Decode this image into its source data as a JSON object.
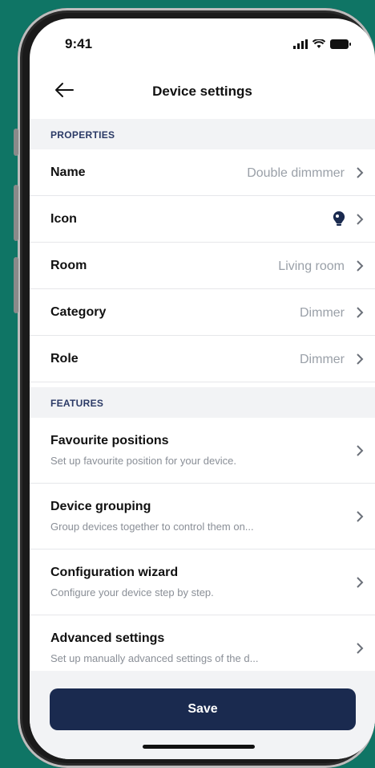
{
  "status_bar": {
    "time": "9:41"
  },
  "header": {
    "title": "Device settings"
  },
  "properties": {
    "section_label": "PROPERTIES",
    "rows": [
      {
        "label": "Name",
        "value": "Double dimmmer"
      },
      {
        "label": "Icon",
        "value": "lightbulb-icon"
      },
      {
        "label": "Room",
        "value": "Living room"
      },
      {
        "label": "Category",
        "value": "Dimmer"
      },
      {
        "label": "Role",
        "value": "Dimmer"
      }
    ]
  },
  "features": {
    "section_label": "FEATURES",
    "items": [
      {
        "title": "Favourite positions",
        "subtitle": "Set up favourite position for your device."
      },
      {
        "title": "Device grouping",
        "subtitle": "Group devices together to control them on..."
      },
      {
        "title": "Configuration wizard",
        "subtitle": "Configure your device step by step."
      },
      {
        "title": "Advanced settings",
        "subtitle": "Set up manually advanced settings of the d..."
      }
    ]
  },
  "footer": {
    "save_label": "Save"
  },
  "colors": {
    "background": "#0f7565",
    "primary": "#1a2a4f",
    "section_bg": "#f2f3f5"
  }
}
